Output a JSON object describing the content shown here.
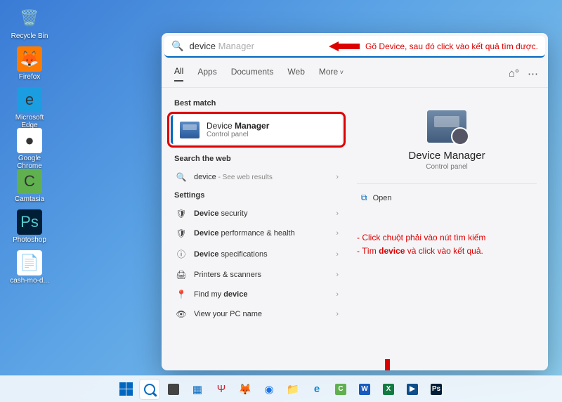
{
  "desktop_icons": [
    {
      "label": "Recycle Bin",
      "glyph": "🗑️",
      "bg": "transparent"
    },
    {
      "label": "Firefox",
      "glyph": "🦊",
      "bg": "#ff7b00"
    },
    {
      "label": "Microsoft Edge",
      "glyph": "e",
      "bg": "#1b9de2"
    },
    {
      "label": "Google Chrome",
      "glyph": "●",
      "bg": "#fff"
    },
    {
      "label": "Camtasia",
      "glyph": "C",
      "bg": "#60b050"
    },
    {
      "label": "Photoshop",
      "glyph": "Ps",
      "bg": "#001e36"
    },
    {
      "label": "cash-mo-d...",
      "glyph": "📄",
      "bg": "#fff"
    }
  ],
  "search": {
    "typed": "device",
    "suggestion_suffix": " Manager",
    "instruction_top": "Gõ Device, sau đó click vào kết quả tìm được."
  },
  "tabs": [
    "All",
    "Apps",
    "Documents",
    "Web",
    "More"
  ],
  "best_match_header": "Best match",
  "best_match": {
    "title_plain": "Device ",
    "title_bold": "Manager",
    "subtitle": "Control panel"
  },
  "search_web_header": "Search the web",
  "web_row": {
    "term": "device",
    "suffix": " - See web results"
  },
  "settings_header": "Settings",
  "settings_rows": [
    {
      "icon": "🛡",
      "bold": "Device",
      "rest": " security"
    },
    {
      "icon": "🛡",
      "bold": "Device",
      "rest": " performance & health"
    },
    {
      "icon": "ⓘ",
      "bold": "Device",
      "rest": " specifications"
    },
    {
      "icon": "🖨",
      "bold": "",
      "rest": "Printers & scanners"
    },
    {
      "icon": "📍",
      "bold": "device",
      "rest_prefix": "Find my "
    },
    {
      "icon": "👁",
      "bold": "",
      "rest": "View your PC name"
    }
  ],
  "detail": {
    "title": "Device Manager",
    "subtitle": "Control panel",
    "open": "Open"
  },
  "side_instructions": {
    "line1": "- Click chuột phải vào nút tìm kiếm",
    "line2_before": "- Tìm ",
    "line2_bold": "device",
    "line2_after": " và click vào kết quả."
  },
  "taskbar": [
    {
      "name": "start",
      "type": "winlogo"
    },
    {
      "name": "search",
      "type": "search",
      "active": true
    },
    {
      "name": "taskview",
      "type": "sq",
      "bg": "#444",
      "glyph": ""
    },
    {
      "name": "widgets",
      "type": "glyph",
      "glyph": "▦",
      "color": "#0067c0"
    },
    {
      "name": "snip",
      "type": "glyph",
      "glyph": "Ψ",
      "color": "#c23"
    },
    {
      "name": "firefox",
      "type": "glyph",
      "glyph": "🦊"
    },
    {
      "name": "chrome",
      "type": "glyph",
      "glyph": "◉",
      "color": "#1a73e8"
    },
    {
      "name": "explorer",
      "type": "glyph",
      "glyph": "📁"
    },
    {
      "name": "edge",
      "type": "glyph",
      "glyph": "e",
      "color": "#0b8ad1",
      "style": "font-weight:700"
    },
    {
      "name": "camtasia",
      "type": "sq",
      "bg": "#60b050",
      "glyph": "C"
    },
    {
      "name": "word",
      "type": "sq",
      "bg": "#185abd",
      "glyph": "W"
    },
    {
      "name": "excel",
      "type": "sq",
      "bg": "#107c41",
      "glyph": "X"
    },
    {
      "name": "powerpoint",
      "type": "sq",
      "bg": "#0f4e8a",
      "glyph": "▶"
    },
    {
      "name": "photoshop",
      "type": "sq",
      "bg": "#001e36",
      "glyph": "Ps"
    }
  ]
}
